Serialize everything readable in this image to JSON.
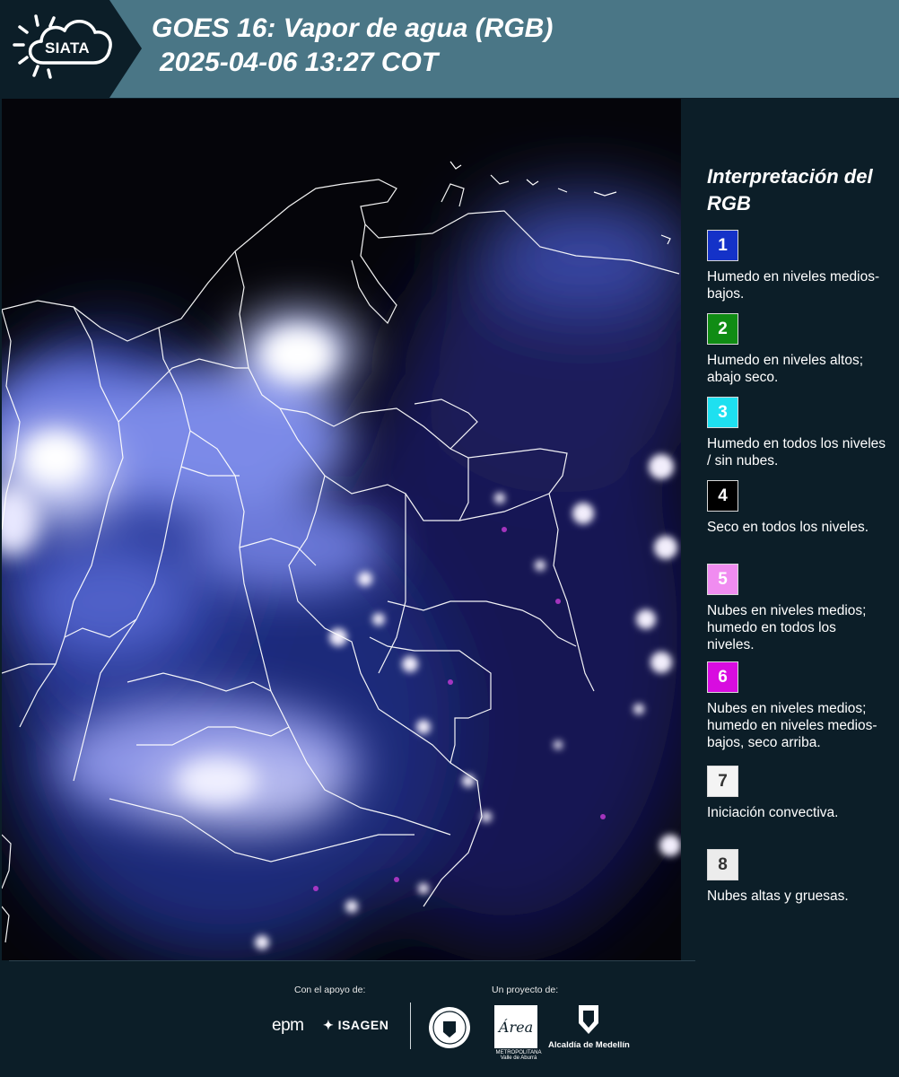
{
  "header": {
    "logo_text": "SIATA",
    "title_line1": "GOES 16: Vapor de agua (RGB)",
    "title_line2": "2025-04-06 13:27 COT"
  },
  "map": {
    "background_color": "#05050a",
    "border_color": "#ffffff"
  },
  "legend": {
    "title": "Interpretación del RGB",
    "items": [
      {
        "number": "1",
        "color": "#1432c8",
        "text_color": "#ffffff",
        "description": "Humedo en niveles medios-bajos."
      },
      {
        "number": "2",
        "color": "#108c14",
        "text_color": "#ffffff",
        "description": "Humedo en niveles altos; abajo seco."
      },
      {
        "number": "3",
        "color": "#1ee0f0",
        "text_color": "#ffffff",
        "description": "Humedo en todos los niveles / sin nubes."
      },
      {
        "number": "4",
        "color": "#000000",
        "text_color": "#ffffff",
        "description": "Seco en todos los niveles."
      },
      {
        "number": "5",
        "color": "#f08cf0",
        "text_color": "#ffffff",
        "description": "Nubes en niveles medios; humedo en todos los niveles."
      },
      {
        "number": "6",
        "color": "#d80ce0",
        "text_color": "#ffffff",
        "description": "Nubes en niveles medios; humedo en niveles medios-bajos, seco arriba."
      },
      {
        "number": "7",
        "color": "#f4f4f4",
        "text_color": "#333333",
        "description": "Iniciación convectiva."
      },
      {
        "number": "8",
        "color": "#ececec",
        "text_color": "#333333",
        "description": "Nubes altas y gruesas."
      }
    ]
  },
  "footer": {
    "support_label": "Con el apoyo de:",
    "project_label": "Un proyecto de:",
    "epm": "epm",
    "isagen": "ISAGEN",
    "area_logo_text": "METROPOLITANA Valle de Aburrá",
    "area_wordmark": "Área",
    "medellin_text": "Alcaldía de Medellín"
  }
}
